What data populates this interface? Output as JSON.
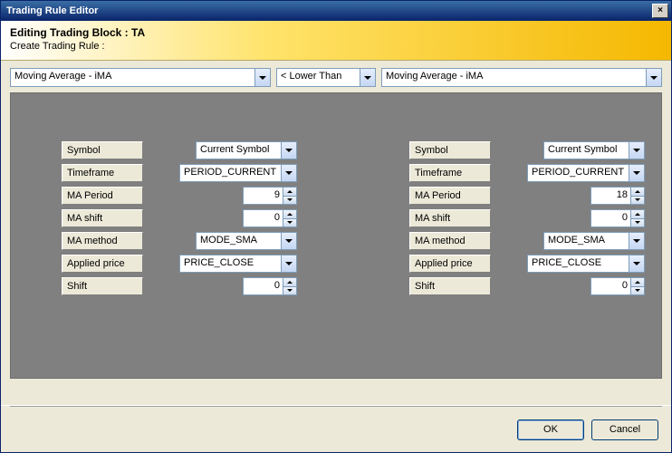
{
  "window": {
    "title": "Trading Rule Editor",
    "close_glyph": "×"
  },
  "header": {
    "title": "Editing Trading Block : TA",
    "subtitle": "Create Trading Rule :"
  },
  "rule_bar": {
    "left_indicator": "Moving Average - iMA",
    "operator": "< Lower Than",
    "right_indicator": "Moving Average - iMA"
  },
  "labels": {
    "symbol": "Symbol",
    "timeframe": "Timeframe",
    "ma_period": "MA Period",
    "ma_shift": "MA shift",
    "ma_method": "MA method",
    "applied_price": "Applied price",
    "shift": "Shift"
  },
  "left": {
    "symbol": "Current Symbol",
    "timeframe": "PERIOD_CURRENT",
    "ma_period": "9",
    "ma_shift": "0",
    "ma_method": "MODE_SMA",
    "applied_price": "PRICE_CLOSE",
    "shift": "0"
  },
  "right": {
    "symbol": "Current Symbol",
    "timeframe": "PERIOD_CURRENT",
    "ma_period": "18",
    "ma_shift": "0",
    "ma_method": "MODE_SMA",
    "applied_price": "PRICE_CLOSE",
    "shift": "0"
  },
  "footer": {
    "ok": "OK",
    "cancel": "Cancel"
  }
}
